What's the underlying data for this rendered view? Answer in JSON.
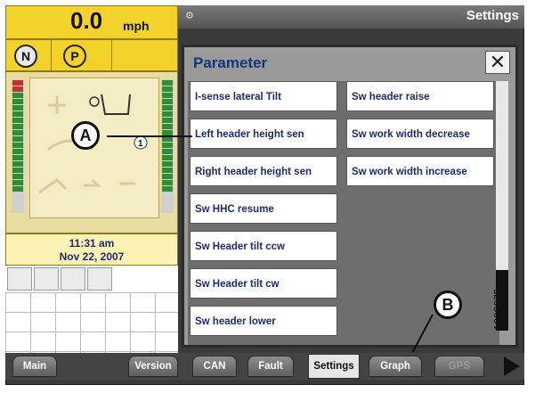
{
  "status": {
    "speed_value": "0.0",
    "speed_unit": "mph",
    "gear_neutral": "N",
    "gear_park": "P",
    "time": "11:31 am",
    "date": "Nov 22, 2007",
    "numeric_indicator": "1"
  },
  "topbar": {
    "title": "Settings"
  },
  "dialog": {
    "title": "Parameter",
    "close_label": "✕",
    "column_left": [
      "I-sense lateral Tilt",
      "Left header height sen",
      "Right header height sen",
      "Sw HHC resume",
      "Sw Header tilt ccw",
      "Sw Header tilt cw",
      "Sw header lower"
    ],
    "column_right": [
      "Sw header raise",
      "Sw work width decrease",
      "Sw work width increase"
    ]
  },
  "tabs": {
    "main": "Main",
    "version": "Version",
    "can": "CAN",
    "fault": "Fault",
    "settings": "Settings",
    "graph": "Graph",
    "gps": "GPS"
  },
  "callouts": {
    "a": "A",
    "b": "B"
  },
  "figure_number": "1003675",
  "colors": {
    "accent_yellow": "#f3d22c",
    "title_blue": "#14357a",
    "panel_grey": "#9a9a9a"
  }
}
